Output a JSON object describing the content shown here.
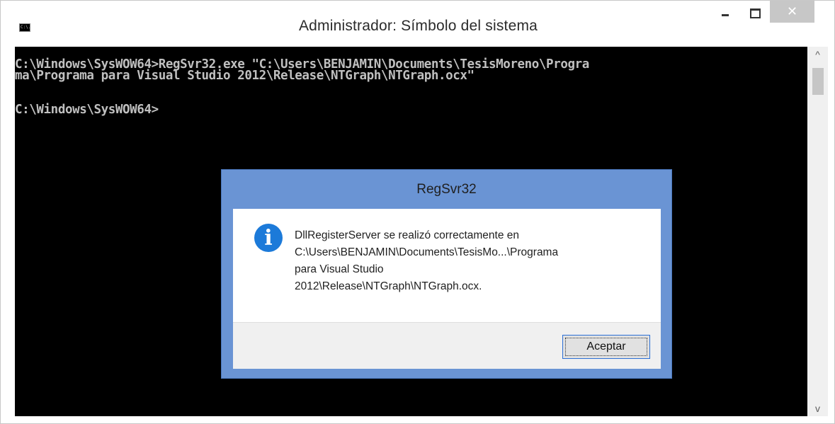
{
  "window": {
    "title": "Administrador: Símbolo del sistema",
    "icon_name": "cmd-icon",
    "icon_text": "C:\\.",
    "controls": {
      "minimize": "minimize-icon",
      "maximize": "maximize-icon",
      "close_label": "✕"
    }
  },
  "console": {
    "lines": [
      "C:\\Windows\\SysWOW64>RegSvr32.exe \"C:\\Users\\BENJAMIN\\Documents\\TesisMoreno\\Progra",
      "ma\\Programa para Visual Studio 2012\\Release\\NTGraph\\NTGraph.ocx\"",
      "C:\\Windows\\SysWOW64>"
    ],
    "text_color": "#c0c0c0",
    "background": "#000000"
  },
  "scrollbar": {
    "up_arrow": "^",
    "down_arrow": "v"
  },
  "dialog": {
    "title": "RegSvr32",
    "icon_name": "info-icon",
    "icon_glyph": "i",
    "message_lines": [
      "DllRegisterServer se realizó correctamente en",
      "C:\\Users\\BENJAMIN\\Documents\\TesisMo...\\Programa",
      "para Visual Studio",
      "2012\\Release\\NTGraph\\NTGraph.ocx."
    ],
    "ok_button": "Aceptar",
    "frame_color": "#6a94d4"
  }
}
